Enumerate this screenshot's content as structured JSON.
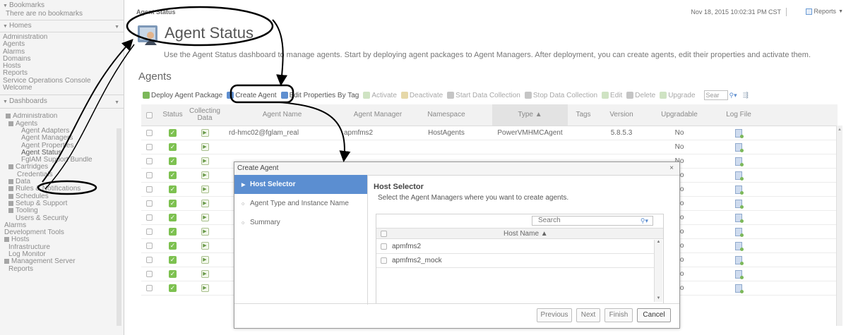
{
  "nav": {
    "bookmarks": {
      "label": "Bookmarks",
      "empty": "There are no bookmarks"
    },
    "homes": {
      "label": "Homes",
      "items": [
        "Administration",
        "Agents",
        "Alarms",
        "Domains",
        "Hosts",
        "Reports",
        "Service Operations Console",
        "Welcome"
      ]
    },
    "dashboards": {
      "label": "Dashboards",
      "items": [
        "Administration",
        "Agents",
        "Agent Adapters",
        "Agent Managers",
        "Agent Properties",
        "Agent Status",
        "FglAM Support Bundle",
        "Cartridges",
        "Credentials",
        "Data",
        "Rules & Notifications",
        "Schedules",
        "Setup & Support",
        "Tooling",
        "Users & Security",
        "Alarms",
        "Development Tools",
        "Hosts",
        "Infrastructure",
        "Log Monitor",
        "Management Server",
        "Reports"
      ]
    }
  },
  "header": {
    "breadcrumb": "Agent Status",
    "timestamp": "Nov 18, 2015 10:02:31 PM CST",
    "reports_label": "Reports",
    "title": "Agent Status",
    "description": "Use the Agent Status dashboard to manage agents. Start by deploying agent packages to Agent Managers. After deployment, you can create agents, edit their properties and activate them.",
    "section": "Agents"
  },
  "toolbar": {
    "deploy": "Deploy Agent Package",
    "create": "Create Agent",
    "edit_tag": "Edit Properties By Tag",
    "activate": "Activate",
    "deactivate": "Deactivate",
    "start": "Start Data Collection",
    "stop": "Stop Data Collection",
    "edit": "Edit",
    "delete": "Delete",
    "upgrade": "Upgrade",
    "search": "Sear"
  },
  "table": {
    "columns": {
      "status": "Status",
      "collecting": "Collecting Data",
      "name": "Agent Name",
      "manager": "Agent Manager",
      "namespace": "Namespace",
      "type": "Type ▲",
      "tags": "Tags",
      "version": "Version",
      "upgradable": "Upgradable",
      "logfile": "Log File"
    },
    "first_row": {
      "name": "rd-hmc02@fglam_real",
      "manager": "apmfms2",
      "namespace": "HostAgents",
      "type": "PowerVMHMCAgent",
      "version": "5.8.5.3"
    },
    "upgradable_value": "No"
  },
  "dialog": {
    "title": "Create Agent",
    "close": "×",
    "steps": [
      "Host Selector",
      "Agent Type and Instance Name",
      "Summary"
    ],
    "heading": "Host Selector",
    "instruction": "Select the Agent Managers where you want to create agents.",
    "search_placeholder": "Search",
    "column": "Host Name ▲",
    "hosts": [
      "apmfms2",
      "apmfms2_mock"
    ],
    "buttons": {
      "previous": "Previous",
      "next": "Next",
      "finish": "Finish",
      "cancel": "Cancel"
    }
  },
  "colors": {
    "accent": "#5b8ed1",
    "ok": "#7dc150",
    "annotation": "#000000"
  }
}
